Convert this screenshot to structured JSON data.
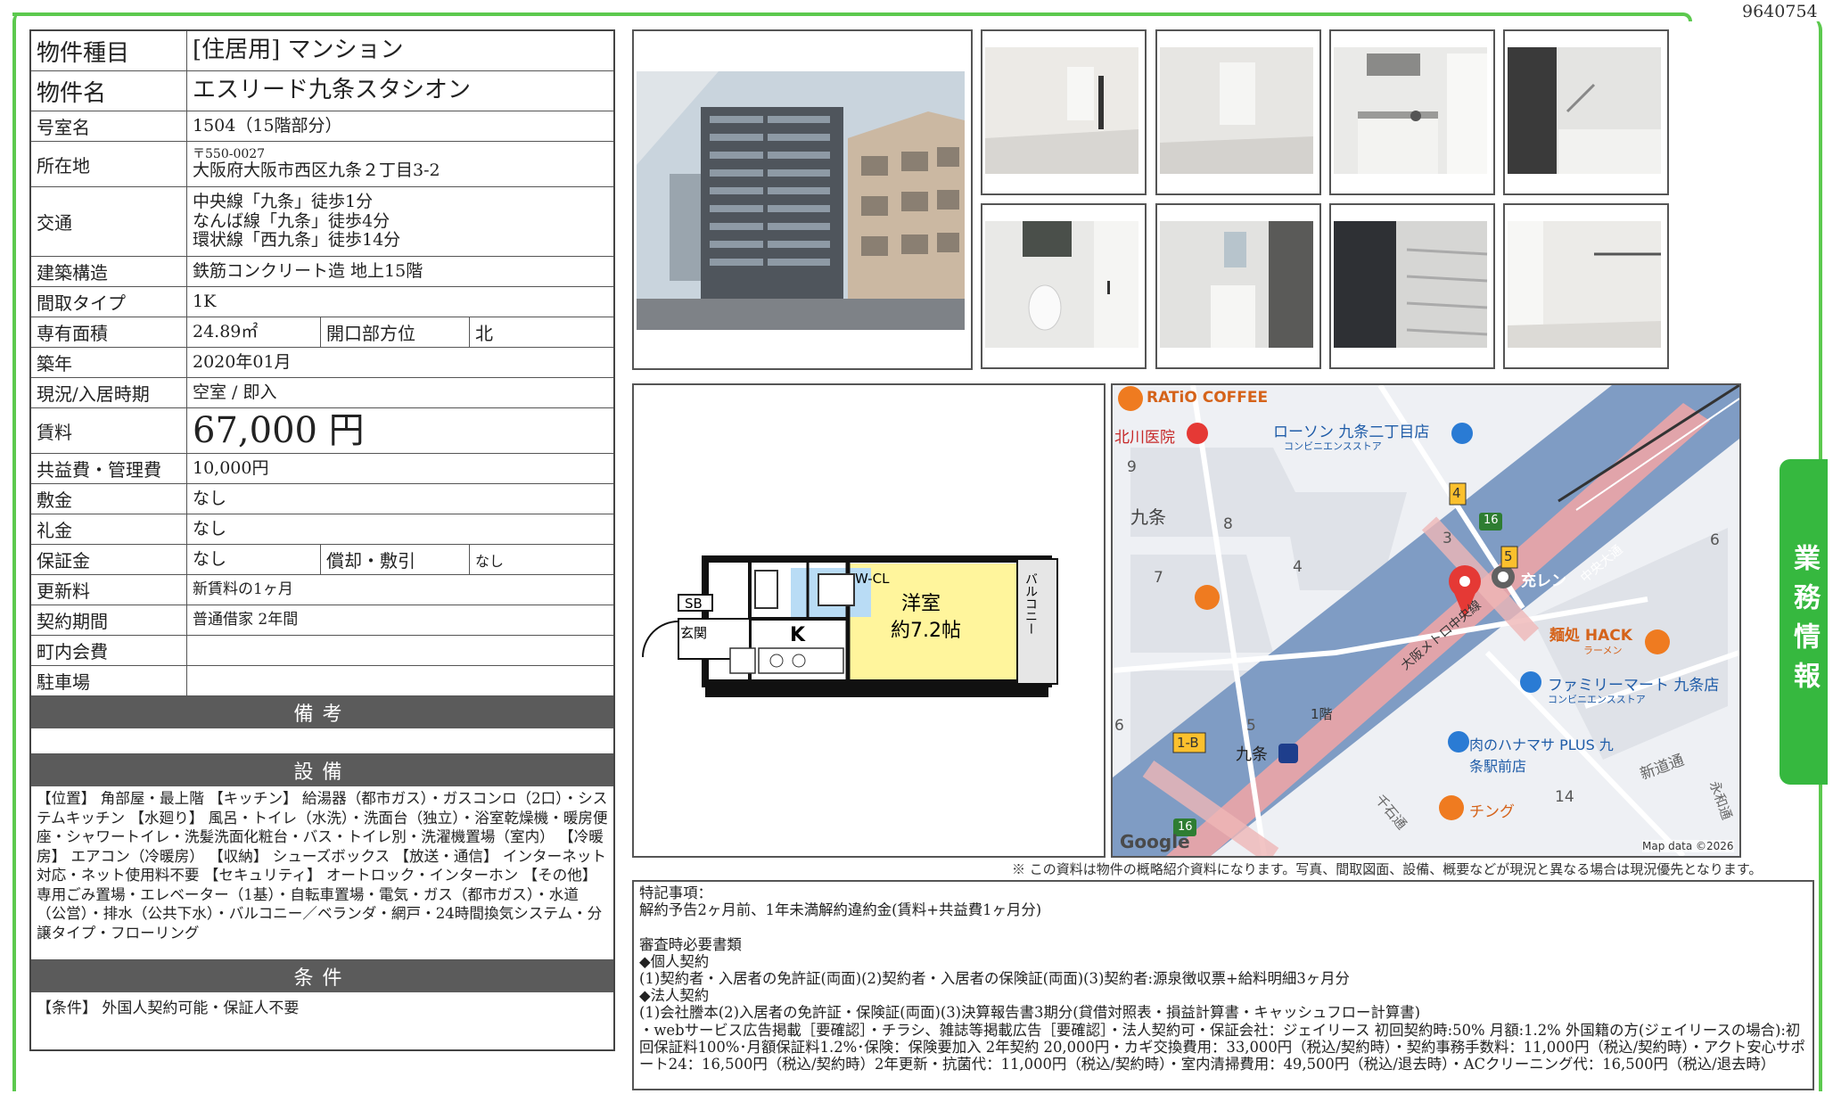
{
  "property_id": "9640754",
  "side_tab": "業務情報",
  "info": {
    "type_label": "物件種目",
    "type_value": "[住居用] マンション",
    "name_label": "物件名",
    "name_value": "エスリード九条スタシオン",
    "room_label": "号室名",
    "room_value": "1504（15階部分）",
    "address_label": "所在地",
    "zip": "〒550-0027",
    "address": "大阪府大阪市西区九条２丁目3-2",
    "transport_label": "交通",
    "transport": [
      "中央線「九条」徒歩1分",
      "なんば線「九条」徒歩4分",
      "環状線「西九条」徒歩14分"
    ],
    "structure_label": "建築構造",
    "structure_value": "鉄筋コンクリート造 地上15階",
    "layout_label": "間取タイプ",
    "layout_value": "1K",
    "area_label": "専有面積",
    "area_value": "24.89㎡",
    "direction_label": "開口部方位",
    "direction_value": "北",
    "built_label": "築年",
    "built_value": "2020年01月",
    "status_label": "現況/入居時期",
    "status_value": "空室 / 即入",
    "rent_label": "賃料",
    "rent_value": "67,000 円",
    "fee_label": "共益費・管理費",
    "fee_value": "10,000円",
    "deposit_label": "敷金",
    "deposit_value": "なし",
    "key_money_label": "礼金",
    "key_money_value": "なし",
    "guarantee_label": "保証金",
    "guarantee_value": "なし",
    "amort_label": "償却・敷引",
    "amort_value": "なし",
    "renewal_label": "更新料",
    "renewal_value": "新賃料の1ヶ月",
    "contract_label": "契約期間",
    "contract_value": "普通借家 2年間",
    "community_label": "町内会費",
    "community_value": "",
    "parking_label": "駐車場",
    "parking_value": ""
  },
  "sections": {
    "memo": "備考",
    "equipment": "設備",
    "conditions": "条件"
  },
  "equipment_text": "【位置】 角部屋・最上階 【キッチン】 給湯器（都市ガス）・ガスコンロ（2口）・システムキッチン 【水廻り】 風呂・トイレ（水洗）・洗面台（独立）・浴室乾燥機・暖房便座・シャワートイレ・洗髪洗面化粧台・バス・トイレ別・洗濯機置場（室内） 【冷暖房】 エアコン（冷暖房） 【収納】 シューズボックス 【放送・通信】 インターネット対応・ネット使用料不要 【セキュリティ】 オートロック・インターホン 【その他】 専用ごみ置場・エレベーター（1基）・自転車置場・電気・ガス（都市ガス）・水道（公営）・排水（公共下水）・バルコニー／ベランダ・網戸・24時間換気システム・分譲タイプ・フローリング",
  "conditions_text": "【条件】 外国人契約可能・保証人不要",
  "floorplan": {
    "room_name": "洋室",
    "room_size": "約7.2帖",
    "kitchen": "K",
    "entrance": "玄関",
    "shoe_box": "SB",
    "closet": "W-CL",
    "balcony": "バルコニー"
  },
  "map": {
    "poi": {
      "ratio": "RATiO COFFEE",
      "clinic": "北川医院",
      "lawson": "ローソン 九条二丁目店",
      "lawson_sub": "コンビニエンスストア",
      "kujo": "九条",
      "juuren": "充レン",
      "osaka_metro": "大阪メトロ中央線",
      "chuo_dori": "中央大通",
      "hack": "麺処 HACK",
      "hack_sub": "ラーメン",
      "familymart": "ファミリーマート 九条店",
      "familymart_sub": "コンビニエンスストア",
      "station": "九条",
      "hanamasa": "肉のハナマサ PLUS 九条駅前店",
      "chinge": "チング",
      "shin_dori": "新道通",
      "eiwa": "永和通",
      "sengoku": "千石通",
      "floor": "1階",
      "exit_1b": "1-B",
      "exit_4": "4",
      "exit_5": "5",
      "route_16": "16",
      "google": "Google",
      "attribution": "Map data ©2026"
    },
    "blocks": [
      "9",
      "8",
      "7",
      "4",
      "3",
      "6",
      "5",
      "14",
      "6"
    ]
  },
  "notice": "※ この資料は物件の概略紹介資料になります。写真、間取図面、設備、概要などが現況と異なる場合は現況優先となります。",
  "remarks": [
    "特記事項：",
    "解約予告2ヶ月前、1年未満解約違約金(賃料+共益費1ヶ月分)",
    "",
    "審査時必要書類",
    "◆個人契約",
    "(1)契約者・入居者の免許証(両面)(2)契約者・入居者の保険証(両面)(3)契約者:源泉徴収票+給料明細3ヶ月分",
    "◆法人契約",
    "(1)会社謄本(2)入居者の免許証・保険証(両面)(3)決算報告書3期分(貸借対照表・損益計算書・キャッシュフロー計算書)",
    "・webサービス広告掲載［要確認］・チラシ、雑誌等掲載広告［要確認］・法人契約可・保証会社：ジェイリース 初回契約時:50% 月額:1.2% 外国籍の方(ジェイリースの場合):初回保証料100%･月額保証料1.2%･保険：保険要加入 2年契約 20,000円・カギ交換費用：33,000円（税込/契約時）・契約事務手数料：11,000円（税込/契約時）・アクト安心サポート24：16,500円（税込/契約時）2年更新・抗菌代：11,000円（税込/契約時）・室内清掃費用：49,500円（税込/退去時）・ACクリーニング代：16,500円（税込/退去時）"
  ]
}
